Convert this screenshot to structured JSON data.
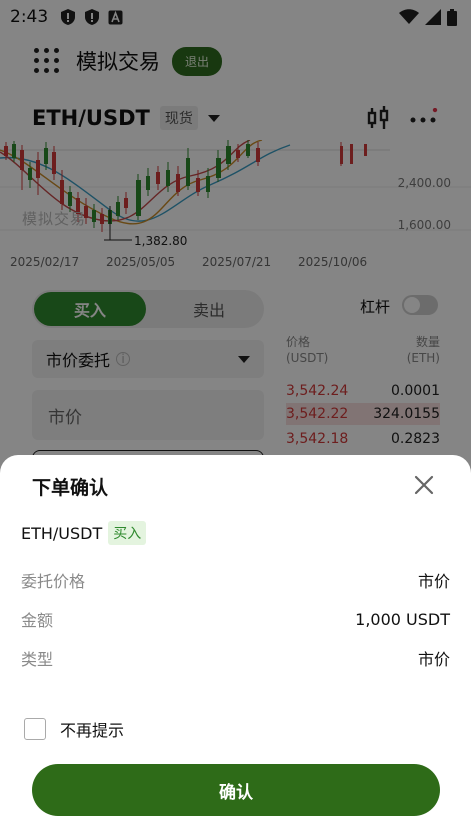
{
  "status_bar": {
    "time": "2:43"
  },
  "app_bar": {
    "title": "模拟交易",
    "exit_label": "退出"
  },
  "pair_bar": {
    "pair": "ETH/USDT",
    "market_tag": "现货"
  },
  "chart": {
    "y_labels": [
      "2,400.00",
      "1,600.00"
    ],
    "min_label": "1,382.80",
    "watermark": "模拟交易",
    "dates": [
      "2025/02/17",
      "2025/05/05",
      "2025/07/21",
      "2025/10/06"
    ]
  },
  "trade": {
    "buy_label": "买入",
    "sell_label": "卖出",
    "leverage_label": "杠杆",
    "order_type": "市价委托",
    "price_placeholder": "市价"
  },
  "orderbook": {
    "price_header": "价格",
    "price_unit": "(USDT)",
    "qty_header": "数量",
    "qty_unit": "(ETH)",
    "rows": [
      {
        "price": "3,542.24",
        "qty": "0.0001"
      },
      {
        "price": "3,542.22",
        "qty": "324.0155"
      },
      {
        "price": "3,542.18",
        "qty": "0.2823"
      }
    ]
  },
  "modal": {
    "title": "下单确认",
    "pair": "ETH/USDT",
    "side": "买入",
    "rows": [
      {
        "label": "委托价格",
        "value": "市价"
      },
      {
        "label": "金额",
        "value": "1,000 USDT"
      },
      {
        "label": "类型",
        "value": "市价"
      }
    ],
    "dont_remind_label": "不再提示",
    "confirm_label": "确认"
  },
  "colors": {
    "accent_green": "#2e6b18",
    "buy_green": "#2f8a2e",
    "ask_red": "#d23b3b"
  }
}
